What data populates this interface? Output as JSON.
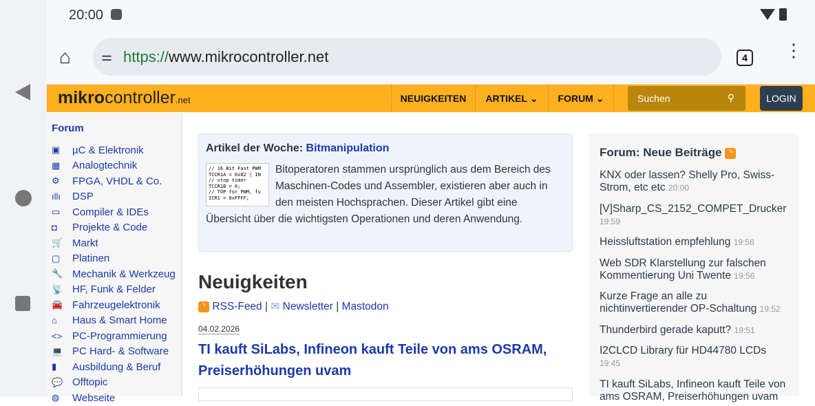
{
  "status": {
    "time": "20:00"
  },
  "browser": {
    "url_scheme": "https://",
    "url_host": "www.mikrocontroller.net",
    "tab_count": "4"
  },
  "site": {
    "logo_bold": "mikro",
    "logo_light": "controller",
    "logo_tld": ".net",
    "nav": [
      "NEUIGKEITEN",
      "ARTIKEL",
      "FORUM"
    ],
    "search_placeholder": "Suchen",
    "login": "LOGIN"
  },
  "sidebar": {
    "title": "Forum",
    "items": [
      {
        "label": "µC & Elektronik",
        "icon": "chip-icon"
      },
      {
        "label": "Analogtechnik",
        "icon": "analog-icon"
      },
      {
        "label": "FPGA, VHDL & Co.",
        "icon": "fpga-icon"
      },
      {
        "label": "DSP",
        "icon": "waveform-icon"
      },
      {
        "label": "Compiler & IDEs",
        "icon": "monitor-icon"
      },
      {
        "label": "Projekte & Code",
        "icon": "project-icon"
      },
      {
        "label": "Markt",
        "icon": "cart-icon"
      },
      {
        "label": "Platinen",
        "icon": "board-icon"
      },
      {
        "label": "Mechanik & Werkzeug",
        "icon": "wrench-icon"
      },
      {
        "label": "HF, Funk & Felder",
        "icon": "antenna-icon"
      },
      {
        "label": "Fahrzeugelektronik",
        "icon": "car-icon"
      },
      {
        "label": "Haus & Smart Home",
        "icon": "home-icon"
      },
      {
        "label": "PC-Programmierung",
        "icon": "code-icon"
      },
      {
        "label": "PC Hard- & Software",
        "icon": "laptop-icon"
      },
      {
        "label": "Ausbildung & Beruf",
        "icon": "book-icon"
      },
      {
        "label": "Offtopic",
        "icon": "chat-icon"
      },
      {
        "label": "Webseite",
        "icon": "globe-icon"
      }
    ]
  },
  "article": {
    "heading": "Artikel der Woche:",
    "link": "Bitmanipulation",
    "code": "// 16 Bit Fast PWM\nTCCR1A = 0x82 | IN\n// stop timer\nTCCR1B = 0;\n// TOP for PWM, fu\nICR1 = 0xFFFF;",
    "text": "Bitoperatoren stammen ursprünglich aus dem Bereich des Maschinen-Codes und Assembler, existieren aber auch in den meisten Hochsprachen. Dieser Artikel gibt eine Übersicht über die wichtigsten Operationen und deren Anwendung."
  },
  "news": {
    "title": "Neuigkeiten",
    "rss": "RSS-Feed",
    "newsletter": "Newsletter",
    "mastodon": "Mastodon",
    "sep": "|",
    "date": "04.02.2026",
    "headline": "TI kauft SiLabs, Infineon kauft Teile von ams OSRAM, Preiserhöhungen uvam"
  },
  "forum_posts": {
    "title": "Forum: Neue Beiträge",
    "posts": [
      {
        "title": "KNX oder lassen? Shelly Pro, Swiss-Strom, etc etc",
        "time": "20:00"
      },
      {
        "title": "[V]Sharp_CS_2152_COMPET_Drucker",
        "time": "19:59"
      },
      {
        "title": "Heissluftstation empfehlung",
        "time": "19:58"
      },
      {
        "title": "Web SDR Klarstellung zur falschen Kommentierung Uni Twente",
        "time": "19:56"
      },
      {
        "title": "Kurze Frage an alle zu nichtinvertierender OP-Schaltung",
        "time": "19:52"
      },
      {
        "title": "Thunderbird gerade kaputt?",
        "time": "19:51"
      },
      {
        "title": "I2CLCD Library für HD44780 LCDs",
        "time": "19:45"
      },
      {
        "title": "TI kauft SiLabs, Infineon kauft Teile von ams OSRAM, Preiserhöhungen uvam",
        "time": ""
      }
    ]
  },
  "colors": {
    "brand": "#ffb020",
    "link": "#1b3aa8",
    "login": "#2c3e50"
  }
}
